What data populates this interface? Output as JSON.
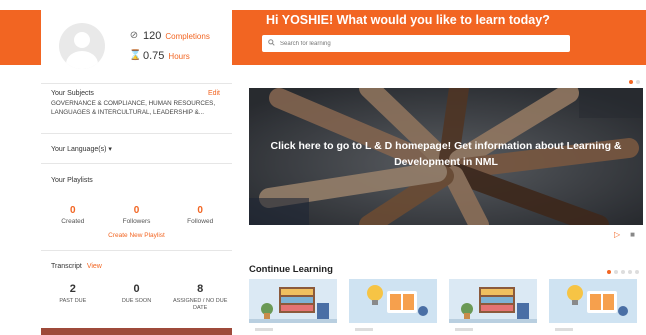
{
  "profile": {
    "completions": {
      "value": "120",
      "label": "Completions",
      "icon": "check-circle-icon"
    },
    "hours": {
      "value": "0.75",
      "label": "Hours",
      "icon": "hourglass-icon"
    }
  },
  "subjects": {
    "title": "Your Subjects",
    "edit_label": "Edit",
    "text": "GOVERNANCE & COMPLIANCE, HUMAN RESOURCES, LANGUAGES & INTERCULTURAL, LEADERSHIP &..."
  },
  "language": {
    "label": "Your Language(s)",
    "caret": "▾"
  },
  "playlists": {
    "title": "Your Playlists",
    "stats": [
      {
        "value": "0",
        "label": "Created"
      },
      {
        "value": "0",
        "label": "Followers"
      },
      {
        "value": "0",
        "label": "Followed"
      }
    ],
    "create_label": "Create New Playlist"
  },
  "transcript": {
    "title": "Transcript",
    "view_label": "View",
    "stats": [
      {
        "value": "2",
        "label": "PAST DUE"
      },
      {
        "value": "0",
        "label": "DUE SOON"
      },
      {
        "value": "8",
        "label": "ASSIGNED / NO DUE DATE"
      }
    ]
  },
  "header": {
    "welcome": "Hi YOSHIE! What would you like to learn today?",
    "search_placeholder": "Search for learning"
  },
  "banner": {
    "text": "Click here to go to L & D homepage! Get information about Learning & Development in NML"
  },
  "media": {
    "play_icon": "play-icon",
    "stop_icon": "stop-icon"
  },
  "continue_learning": {
    "title": "Continue Learning",
    "cards": [
      {
        "theme": "bookshelf-illustration"
      },
      {
        "theme": "lightbulb-book-illustration"
      },
      {
        "theme": "bookshelf-illustration"
      },
      {
        "theme": "lightbulb-book-illustration"
      }
    ]
  },
  "colors": {
    "accent": "#f26522",
    "band": "#f26522",
    "card_blue": "#cfe3f2"
  }
}
